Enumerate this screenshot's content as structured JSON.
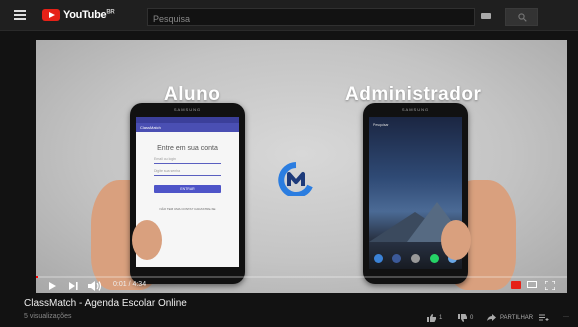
{
  "header": {
    "logo_text": "YouTube",
    "logo_region": "BR",
    "search_placeholder": "Pesquisa"
  },
  "video": {
    "heading_left": "Aluno",
    "heading_right": "Administrador",
    "phone_brand": "SAMSUNG",
    "left_app": {
      "app_title": "ClassMatch",
      "login_title": "Entre em sua conta",
      "email_placeholder": "Email ou login",
      "password_placeholder": "Digite sua senha",
      "button_label": "ENTRAR",
      "footer_text": "NÃO TEM UMA CONTA? CADASTRE-SE"
    },
    "right_screen": {
      "search_text": "Pesquisar"
    }
  },
  "player": {
    "time": "0:01 / 4:34",
    "progress_percent": 0.4
  },
  "info": {
    "title": "ClassMatch - Agenda Escolar Online",
    "views": "5 visualizações",
    "likes": "1",
    "dislikes": "0",
    "share_label": "PARTILHAR"
  },
  "colors": {
    "accent": "#e62117",
    "app_primary": "#4e54c8"
  }
}
